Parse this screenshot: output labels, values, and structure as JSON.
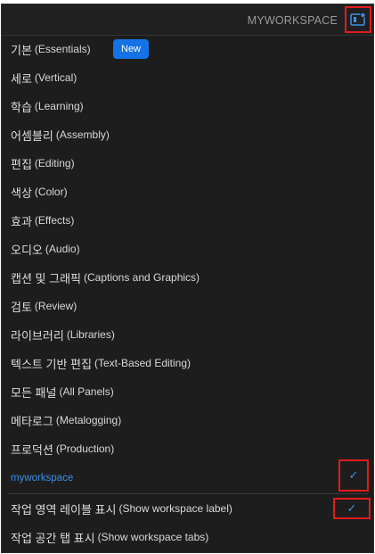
{
  "header": {
    "workspace_title": "MYWORKSPACE",
    "icon": "workspace-panel-icon"
  },
  "menu": {
    "new_badge": "New",
    "items": [
      {
        "ko": "기본",
        "en": "(Essentials)"
      },
      {
        "ko": "세로",
        "en": "(Vertical)"
      },
      {
        "ko": "학습",
        "en": "(Learning)"
      },
      {
        "ko": "어셈블리",
        "en": "(Assembly)"
      },
      {
        "ko": "편집",
        "en": "(Editing)"
      },
      {
        "ko": "색상",
        "en": "(Color)"
      },
      {
        "ko": "효과",
        "en": "(Effects)"
      },
      {
        "ko": "오디오",
        "en": "(Audio)"
      },
      {
        "ko": "캡션 및 그래픽",
        "en": "(Captions and Graphics)"
      },
      {
        "ko": "검토",
        "en": "(Review)"
      },
      {
        "ko": "라이브러리",
        "en": "(Libraries)"
      },
      {
        "ko": "텍스트 기반 편집",
        "en": "(Text-Based Editing)"
      },
      {
        "ko": "모든 패널",
        "en": "(All Panels)"
      },
      {
        "ko": "메타로그",
        "en": "(Metalogging)"
      },
      {
        "ko": "프로덕션",
        "en": "(Production)"
      }
    ],
    "custom_workspace": "myworkspace",
    "options": [
      {
        "ko": "작업 영역 레이블 표시",
        "en": "(Show workspace label)"
      },
      {
        "ko": "작업 공간 탭 표시",
        "en": "(Show workspace tabs)"
      }
    ],
    "checkmark": "✓"
  },
  "colors": {
    "accent": "#1473e6",
    "link": "#3d8fe8",
    "highlight_box": "#e21b1b",
    "background": "#1d1d1d"
  }
}
